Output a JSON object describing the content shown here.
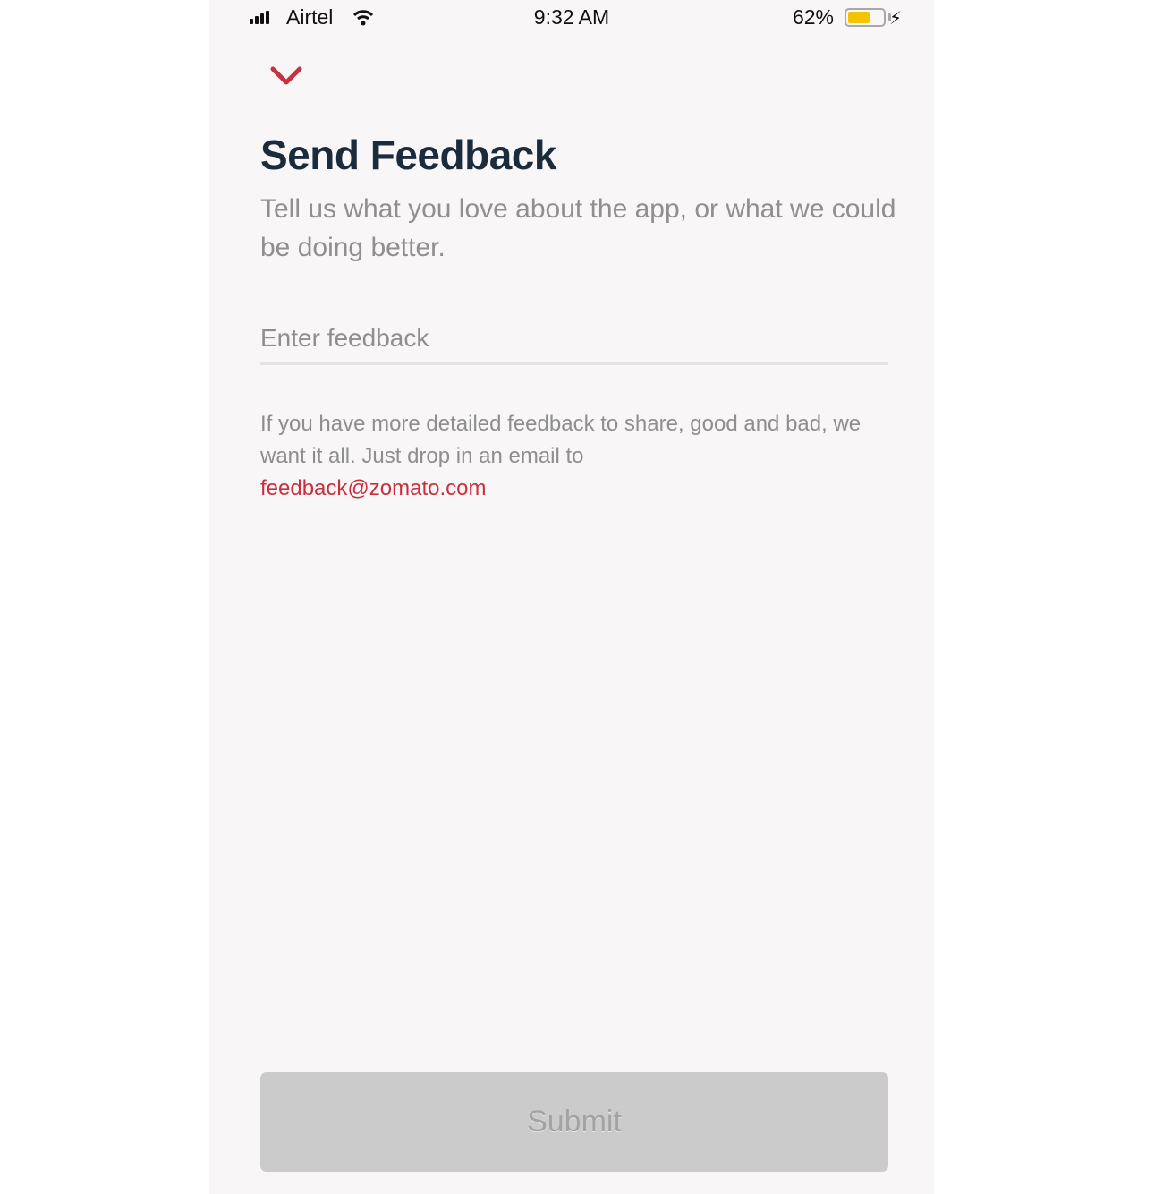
{
  "status_bar": {
    "carrier": "Airtel",
    "time": "9:32 AM",
    "battery_percent_label": "62%",
    "battery_level": 0.62,
    "battery_color": "#f5c400",
    "icons": [
      "signal-icon",
      "wifi-icon",
      "battery-icon",
      "charging-bolt-icon"
    ]
  },
  "header": {
    "close_icon": "chevron-down-icon",
    "accent_color": "#cb2f3f",
    "title": "Send Feedback",
    "subtitle": "Tell us what you love about the app, or what we could be doing better."
  },
  "form": {
    "feedback_value": "",
    "feedback_placeholder": "Enter feedback",
    "info_text": "If you have more detailed feedback to share, good and bad, we want it all. Just drop in an email to",
    "email": "feedback@zomato.com",
    "submit_label": "Submit",
    "submit_enabled": false
  }
}
